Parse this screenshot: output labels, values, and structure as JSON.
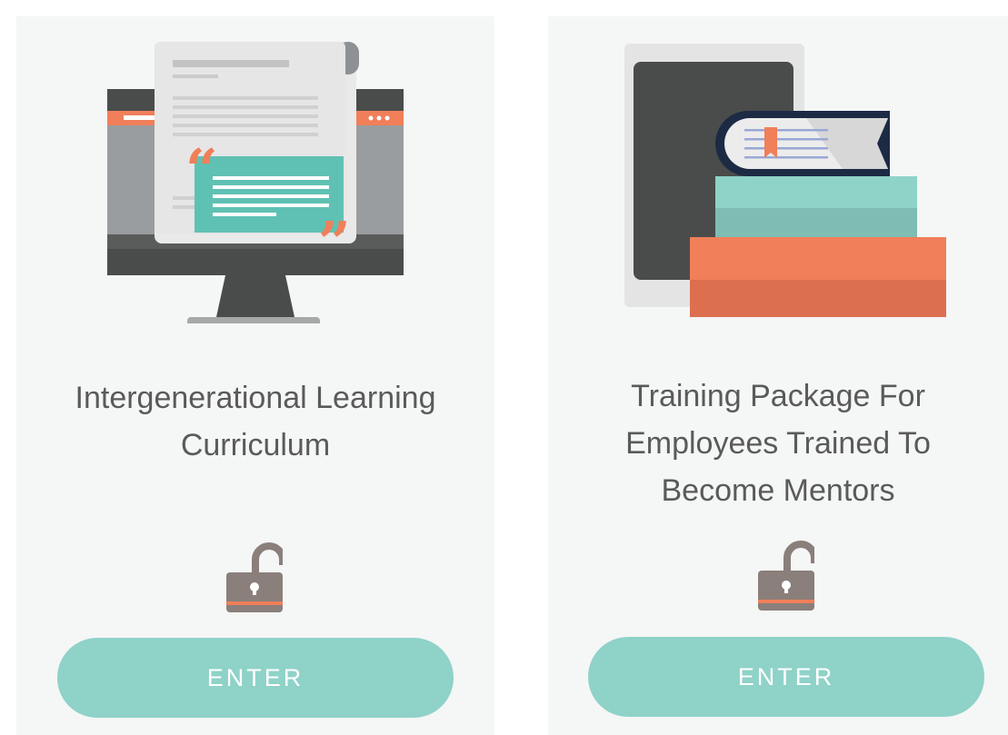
{
  "cards": [
    {
      "title": "Intergenerational Learning Curriculum",
      "button_label": "ENTER",
      "lock_state": "unlocked",
      "illustration": "monitor-document-icon"
    },
    {
      "title": "Training Package For Employees Trained To Become Mentors",
      "button_label": "ENTER",
      "lock_state": "unlocked",
      "illustration": "tablet-books-icon"
    }
  ],
  "colors": {
    "card_bg": "#f5f6f6",
    "button_bg": "#8fd2c8",
    "button_text": "#ffffff",
    "title_text": "#5a5a5a",
    "accent_orange": "#f07f5a",
    "teal": "#5fc1b3",
    "lock_gray": "#8a7f7b"
  }
}
